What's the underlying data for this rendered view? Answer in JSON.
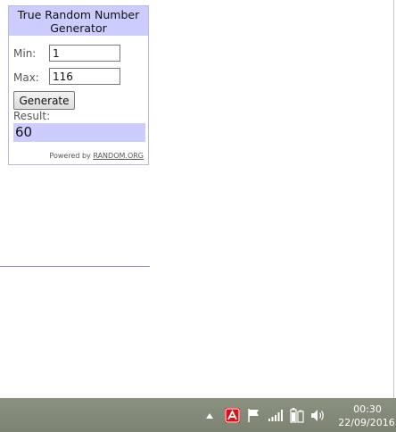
{
  "widget": {
    "title": "True Random Number Generator",
    "min_label": "Min:",
    "min_value": "1",
    "max_label": "Max:",
    "max_value": "116",
    "generate_label": "Generate",
    "result_label": "Result:",
    "result_value": "60",
    "powered_by_text": "Powered by",
    "powered_by_link": "RANDOM.ORG",
    "header_color": "#ccccff"
  },
  "taskbar": {
    "time": "00:30",
    "date": "22/09/2016",
    "tray_icons": [
      "show-hidden-icons-arrow",
      "avira-antivirus-icon",
      "action-center-flag-icon",
      "network-signal-icon",
      "battery-power-icon",
      "volume-icon"
    ]
  }
}
